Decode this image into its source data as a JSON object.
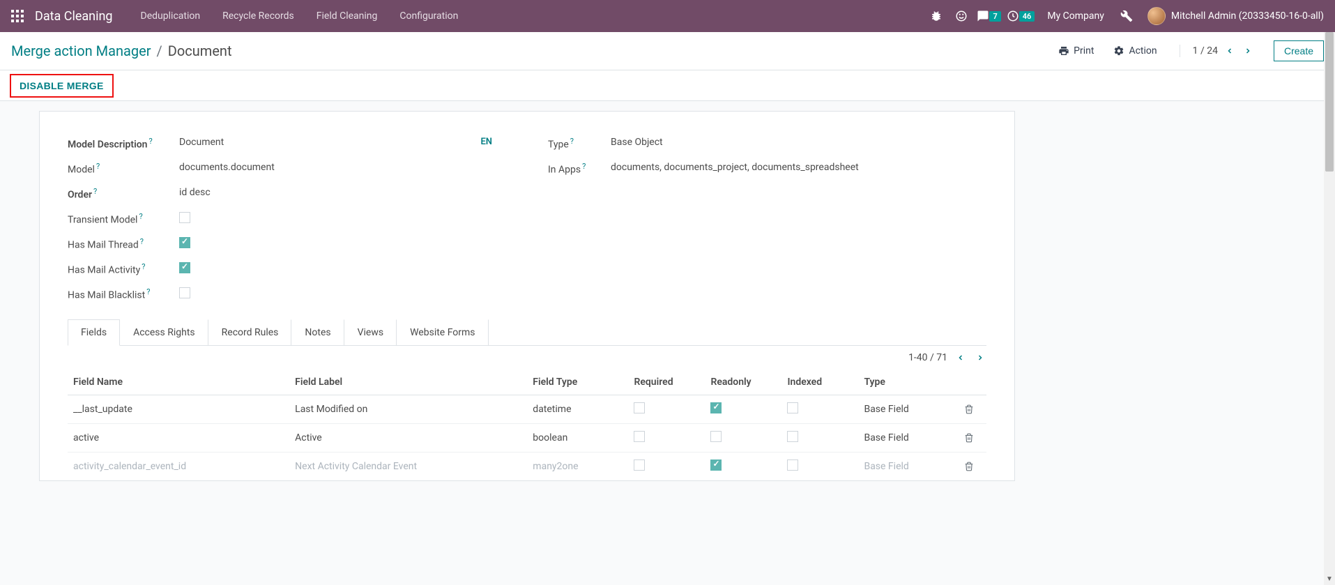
{
  "navbar": {
    "brand": "Data Cleaning",
    "links": [
      "Deduplication",
      "Recycle Records",
      "Field Cleaning",
      "Configuration"
    ],
    "messages_badge": "7",
    "activities_badge": "46",
    "company": "My Company",
    "user": "Mitchell Admin (20333450-16-0-all)"
  },
  "controlbar": {
    "breadcrumb_link": "Merge action Manager",
    "breadcrumb_current": "Document",
    "print": "Print",
    "action": "Action",
    "pager": "1 / 24",
    "create": "Create"
  },
  "statusbar": {
    "disable_merge": "DISABLE MERGE"
  },
  "form": {
    "left": {
      "model_description_label": "Model Description",
      "model_description_value": "Document",
      "model_label": "Model",
      "model_value": "documents.document",
      "order_label": "Order",
      "order_value": "id desc",
      "transient_label": "Transient Model",
      "mail_thread_label": "Has Mail Thread",
      "mail_activity_label": "Has Mail Activity",
      "mail_blacklist_label": "Has Mail Blacklist",
      "lang": "EN"
    },
    "right": {
      "type_label": "Type",
      "type_value": "Base Object",
      "in_apps_label": "In Apps",
      "in_apps_value": "documents, documents_project, documents_spreadsheet"
    }
  },
  "tabs": [
    "Fields",
    "Access Rights",
    "Record Rules",
    "Notes",
    "Views",
    "Website Forms"
  ],
  "sub_pager": "1-40 / 71",
  "table": {
    "headers": {
      "field_name": "Field Name",
      "field_label": "Field Label",
      "field_type": "Field Type",
      "required": "Required",
      "readonly": "Readonly",
      "indexed": "Indexed",
      "type": "Type"
    },
    "rows": [
      {
        "name": "__last_update",
        "label": "Last Modified on",
        "ftype": "datetime",
        "required": false,
        "readonly": true,
        "indexed": false,
        "type": "Base Field"
      },
      {
        "name": "active",
        "label": "Active",
        "ftype": "boolean",
        "required": false,
        "readonly": false,
        "indexed": false,
        "type": "Base Field"
      }
    ],
    "partial_row": {
      "name": "activity_calendar_event_id",
      "label": "Next Activity Calendar Event",
      "ftype": "many2one",
      "type": "Base Field"
    }
  }
}
